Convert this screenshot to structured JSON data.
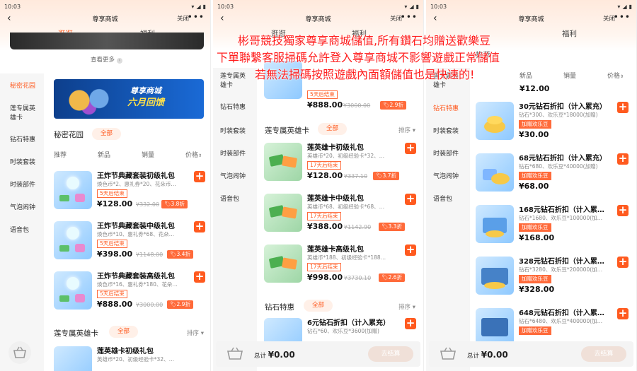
{
  "screens": [
    {
      "status": {
        "time": "10:03"
      },
      "title": "尊享商城",
      "close_label": "关闭",
      "more_icon": "more-dots-icon",
      "tabs": [
        {
          "label": "逛逛",
          "active": true
        },
        {
          "label": "福利",
          "active": false
        }
      ],
      "see_more": "查看更多",
      "sidebar": [
        {
          "label": "秘密花园",
          "active": true
        },
        {
          "label": "莲专属英雄卡",
          "active": false
        },
        {
          "label": "钻石特惠",
          "active": false
        },
        {
          "label": "时装套装",
          "active": false
        },
        {
          "label": "时装部件",
          "active": false
        },
        {
          "label": "气泡闹钟",
          "active": false
        },
        {
          "label": "语音包",
          "active": false
        }
      ],
      "banner": {
        "line1": "尊享商城",
        "line2": "六月回馈"
      },
      "section1": {
        "title": "秘密花园",
        "chip": "全部"
      },
      "filters": {
        "recommend": "推荐",
        "new": "新品",
        "sales": "销量",
        "price": "价格"
      },
      "products": [
        {
          "name": "王炸节典藏套装初级礼包",
          "desc": "焕色币*2、惠礼券*20、花朵币…",
          "badge": "5天后结束",
          "price": "¥128.00",
          "orig": "¥332.00",
          "discount": "3.8折"
        },
        {
          "name": "王炸节典藏套装中级礼包",
          "desc": "焕色币*10、惠礼券*68、花朵…",
          "badge": "5天后结束",
          "price": "¥398.00",
          "orig": "¥1148.00",
          "discount": "3.4折"
        },
        {
          "name": "王炸节典藏套装高级礼包",
          "desc": "焕色币*16、惠礼券*180、花朵…",
          "badge": "5天后结束",
          "price": "¥888.00",
          "orig": "¥3000.00",
          "discount": "2.9折"
        }
      ],
      "section2": {
        "title": "莲专属英雄卡",
        "chip": "全部",
        "sort": "排序"
      },
      "product_peek": {
        "name": "莲英雄卡初级礼包",
        "desc": "英雄币*20、初级经验卡*32、…"
      }
    },
    {
      "status": {
        "time": "10:03"
      },
      "title": "尊享商城",
      "close_label": "关闭",
      "tabs": [
        {
          "label": "逛逛",
          "active": false
        },
        {
          "label": "福利",
          "active": false
        }
      ],
      "sidebar": [
        {
          "label": "莲专属英雄卡",
          "active": false
        },
        {
          "label": "钻石特惠",
          "active": false
        },
        {
          "label": "时装套装",
          "active": false
        },
        {
          "label": "时装部件",
          "active": false
        },
        {
          "label": "气泡闹钟",
          "active": false
        },
        {
          "label": "语音包",
          "active": false
        }
      ],
      "top_peek": {
        "badge": "5天后结束",
        "price": "¥888.00",
        "orig": "¥3000.00",
        "discount": "2.9折"
      },
      "section": {
        "title": "莲专属英雄卡",
        "chip": "全部",
        "sort": "排序"
      },
      "products": [
        {
          "name": "莲英雄卡初级礼包",
          "desc": "英雄币*20、初级经验卡*32、…",
          "badge": "17天后结束",
          "price": "¥128.00",
          "orig": "¥337.10",
          "discount": "3.7折"
        },
        {
          "name": "莲英雄卡中级礼包",
          "desc": "英雄币*68、初级经验卡*68、…",
          "badge": "17天后结束",
          "price": "¥388.00",
          "orig": "¥1142.90",
          "discount": "3.3折"
        },
        {
          "name": "莲英雄卡高级礼包",
          "desc": "英雄币*188、初级经验卡*188…",
          "badge": "17天后结束",
          "price": "¥998.00",
          "orig": "¥3730.10",
          "discount": "2.6折"
        }
      ],
      "section2": {
        "title": "钻石特惠",
        "chip": "全部",
        "sort": "排序"
      },
      "product_peek": {
        "name": "6元钻石折扣（计入累充）",
        "desc": "钻石*60、欢乐豆*3600(加赠)"
      },
      "bottom": {
        "total_label": "总计",
        "total": "¥0.00",
        "checkout": "去结算"
      }
    },
    {
      "status": {
        "time": "10:03"
      },
      "title": "尊享商城",
      "close_label": "关闭",
      "tabs": [
        {
          "label": "推荐",
          "active": false
        },
        {
          "label": "福利",
          "active": false
        }
      ],
      "sidebar": [
        {
          "label": "莲专属英雄卡",
          "active": false
        },
        {
          "label": "钻石特惠",
          "active": true
        },
        {
          "label": "时装套装",
          "active": false
        },
        {
          "label": "时装部件",
          "active": false
        },
        {
          "label": "气泡闹钟",
          "active": false
        },
        {
          "label": "语音包",
          "active": false
        }
      ],
      "filters": {
        "new": "新品",
        "sales": "销量",
        "price": "价格"
      },
      "top_peek": {
        "price": "¥12.00"
      },
      "products": [
        {
          "name": "30元钻石折扣（计入累充）",
          "desc": "钻石*300、欢乐豆*18000(加赠)",
          "badge": "加赠欢乐豆",
          "price": "¥30.00"
        },
        {
          "name": "68元钻石折扣（计入累充）",
          "desc": "钻石*680、欢乐豆*40000(加赠)",
          "badge": "加赠欢乐豆",
          "price": "¥68.00"
        },
        {
          "name": "168元钻石折扣（计入累…",
          "desc": "钻石*1680、欢乐豆*100000(加…",
          "badge": "加赠欢乐豆",
          "price": "¥168.00"
        },
        {
          "name": "328元钻石折扣（计入累…",
          "desc": "钻石*3280、欢乐豆*200000(加…",
          "badge": "加赠欢乐豆",
          "price": "¥328.00"
        },
        {
          "name": "648元钻石折扣（计入累…",
          "desc": "钻石*6480、欢乐豆*400000(加…",
          "badge": "加赠欢乐豆",
          "price": ""
        }
      ],
      "bottom": {
        "total_label": "总计",
        "total": "¥0.00",
        "checkout": "去结算"
      }
    }
  ],
  "overlay_text": [
    "彬哥競技獨家尊享商城儲值,所有鑽石均贈送歡樂豆",
    "下單聯繫客服掃碼允許登入尊享商城不影響遊戲正常儲值",
    "若無法掃碼按照遊戲內面額儲值也是快速的!"
  ],
  "colors": {
    "accent": "#ff5a1f",
    "overlay_red": "#ff1e1e"
  }
}
